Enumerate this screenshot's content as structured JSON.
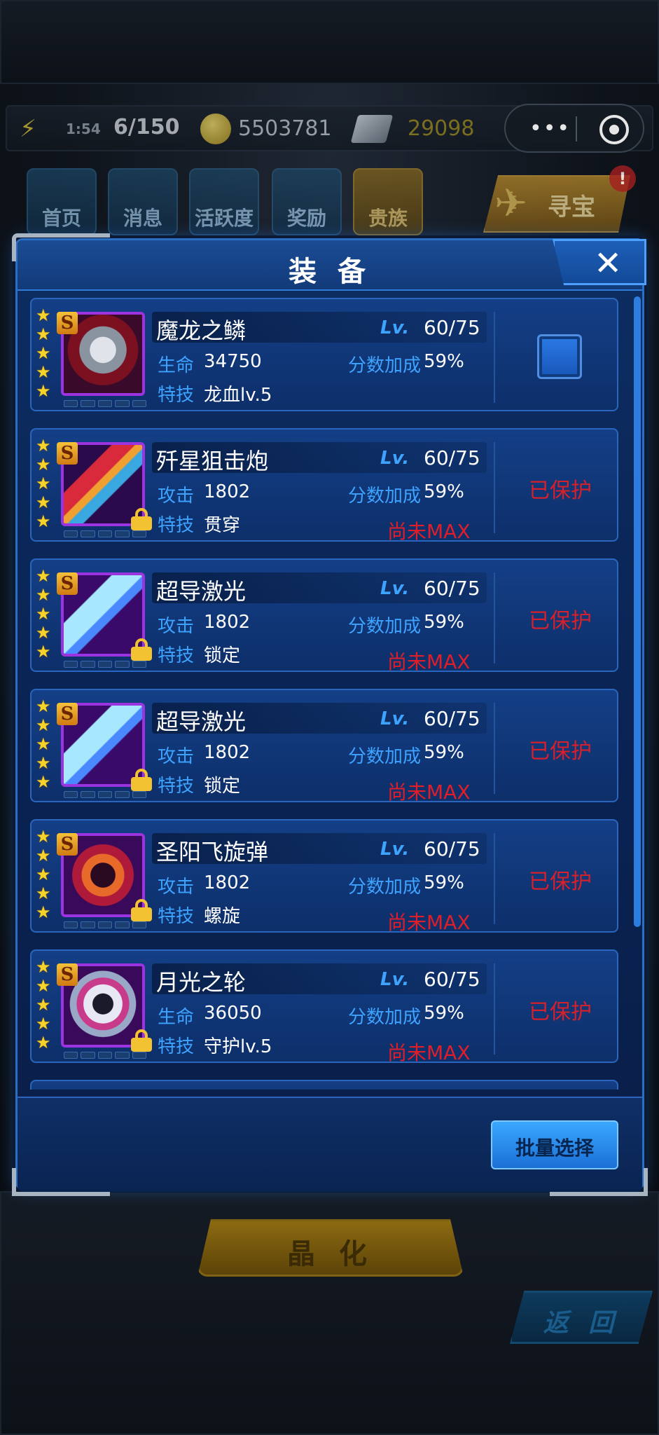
{
  "status_bar": {
    "time": "1:54",
    "energy": "6/150",
    "coins": "5503781",
    "gems": "29098"
  },
  "top_menu": [
    {
      "label": "首页"
    },
    {
      "label": "消息"
    },
    {
      "label": "活跃度"
    },
    {
      "label": "奖励"
    },
    {
      "label": "贵族"
    }
  ],
  "treasure": {
    "label": "寻宝",
    "badge": "!"
  },
  "modal": {
    "title": "装 备",
    "close_label": "✕",
    "batch_button": "批量选择"
  },
  "items": [
    {
      "name": "魔龙之鳞",
      "lv_label": "Lv.",
      "level": "60/75",
      "stat_label": "生命",
      "stat_value": "34750",
      "bonus_label": "分数加成",
      "bonus_value": "59%",
      "skill_label": "特技",
      "skill_value": "龙血lv.5",
      "status": "",
      "max_text": "",
      "selectable": true,
      "locked": false,
      "stars": 5,
      "rank": "S"
    },
    {
      "name": "歼星狙击炮",
      "lv_label": "Lv.",
      "level": "60/75",
      "stat_label": "攻击",
      "stat_value": "1802",
      "bonus_label": "分数加成",
      "bonus_value": "59%",
      "skill_label": "特技",
      "skill_value": "贯穿",
      "status": "已保护",
      "max_text": "尚未MAX",
      "selectable": false,
      "locked": true,
      "stars": 5,
      "rank": "S"
    },
    {
      "name": "超导激光",
      "lv_label": "Lv.",
      "level": "60/75",
      "stat_label": "攻击",
      "stat_value": "1802",
      "bonus_label": "分数加成",
      "bonus_value": "59%",
      "skill_label": "特技",
      "skill_value": "锁定",
      "status": "已保护",
      "max_text": "尚未MAX",
      "selectable": false,
      "locked": true,
      "stars": 5,
      "rank": "S"
    },
    {
      "name": "超导激光",
      "lv_label": "Lv.",
      "level": "60/75",
      "stat_label": "攻击",
      "stat_value": "1802",
      "bonus_label": "分数加成",
      "bonus_value": "59%",
      "skill_label": "特技",
      "skill_value": "锁定",
      "status": "已保护",
      "max_text": "尚未MAX",
      "selectable": false,
      "locked": true,
      "stars": 5,
      "rank": "S"
    },
    {
      "name": "圣阳飞旋弹",
      "lv_label": "Lv.",
      "level": "60/75",
      "stat_label": "攻击",
      "stat_value": "1802",
      "bonus_label": "分数加成",
      "bonus_value": "59%",
      "skill_label": "特技",
      "skill_value": "螺旋",
      "status": "已保护",
      "max_text": "尚未MAX",
      "selectable": false,
      "locked": true,
      "stars": 5,
      "rank": "S"
    },
    {
      "name": "月光之轮",
      "lv_label": "Lv.",
      "level": "60/75",
      "stat_label": "生命",
      "stat_value": "36050",
      "bonus_label": "分数加成",
      "bonus_value": "59%",
      "skill_label": "特技",
      "skill_value": "守护lv.5",
      "status": "已保护",
      "max_text": "尚未MAX",
      "selectable": false,
      "locked": true,
      "stars": 5,
      "rank": "S"
    }
  ],
  "bottom": {
    "crystal_label": "晶 化",
    "back_label": "返 回"
  },
  "colors": {
    "accent_blue": "#3ea3ff",
    "protected_red": "#d8202a",
    "star_gold": "#f6d22a",
    "panel_blue": "#0d2e62"
  }
}
